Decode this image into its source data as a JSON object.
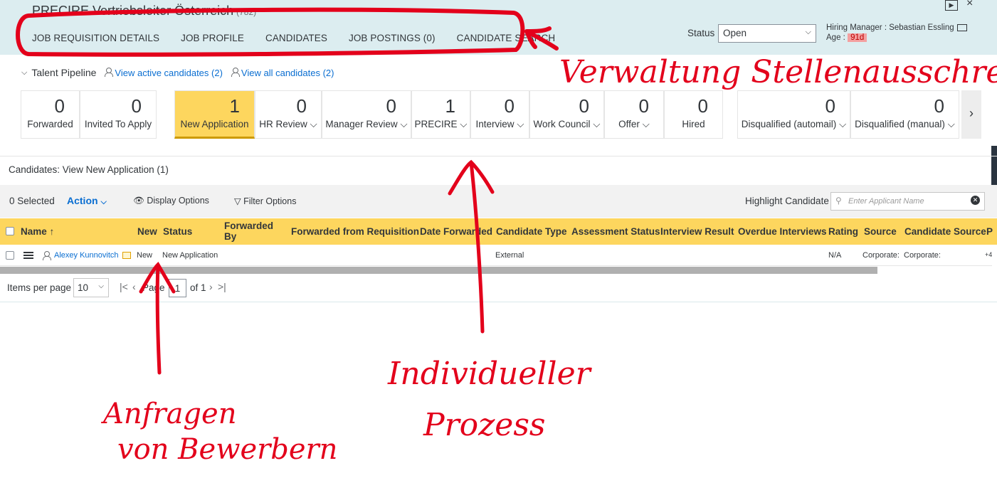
{
  "header": {
    "title": "PRECIRE Vertriebsleiter Österreich",
    "count": "(782)",
    "tabs": [
      "JOB REQUISITION DETAILS",
      "JOB PROFILE",
      "CANDIDATES",
      "JOB POSTINGS (0)",
      "CANDIDATE SEARCH"
    ],
    "status_label": "Status",
    "status_value": "Open",
    "hiring_manager": "Hiring Manager : Sebastian Essling",
    "age_label": "Age :",
    "age_value": "91d"
  },
  "pipeline": {
    "title": "Talent Pipeline",
    "view_active": "View active candidates (2)",
    "view_all": "View all candidates (2)",
    "stages": [
      {
        "count": "0",
        "label": "Forwarded"
      },
      {
        "count": "0",
        "label": "Invited To Apply"
      },
      {
        "count": "1",
        "label": "New Application"
      },
      {
        "count": "0",
        "label": "HR Review ⌵"
      },
      {
        "count": "0",
        "label": "Manager Review ⌵"
      },
      {
        "count": "1",
        "label": "PRECIRE ⌵"
      },
      {
        "count": "0",
        "label": "Interview ⌵"
      },
      {
        "count": "0",
        "label": "Work Council ⌵"
      },
      {
        "count": "0",
        "label": "Offer ⌵"
      },
      {
        "count": "0",
        "label": "Hired"
      },
      {
        "count": "0",
        "label": "Disqualified (automail) ⌵"
      },
      {
        "count": "0",
        "label": "Disqualified (manual) ⌵"
      }
    ]
  },
  "candidates": {
    "view_title": "Candidates: View New Application (1)",
    "selected": "0 Selected",
    "action": "Action",
    "display_options": "Display Options",
    "filter_options": "Filter Options",
    "highlight_label": "Highlight Candidate",
    "highlight_placeholder": "Enter Applicant Name",
    "columns": [
      "Name",
      "New",
      "Status",
      "Forwarded By",
      "Forwarded from Requisition",
      "Date Forwarded",
      "Candidate Type",
      "Assessment Status",
      "Interview Result",
      "Overdue Interviews",
      "Rating",
      "Source",
      "Candidate Source",
      "P"
    ],
    "row": {
      "name": "Alexey Kunnovitch",
      "new": "New",
      "status": "New Application",
      "candidate_type": "External",
      "rating": "N/A",
      "source": "Corporate:",
      "candidate_source": "Corporate:",
      "extra": "+4"
    }
  },
  "pagination": {
    "items_per_page_label": "Items per page",
    "items_per_page": "10",
    "page_label": "Page",
    "page_value": "1",
    "page_of": "of 1"
  },
  "annotations": {
    "top_right": "Verwaltung Stellenausschreibung",
    "bottom_left_line1": "Anfragen",
    "bottom_left_line2": "von Bewerbern",
    "bottom_mid_line1": "Individueller",
    "bottom_mid_line2": "Prozess"
  }
}
